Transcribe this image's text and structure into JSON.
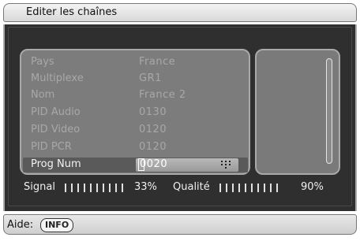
{
  "title": "Editer les chaînes",
  "fields": [
    {
      "label": "Pays",
      "value": "France"
    },
    {
      "label": "Multiplexe",
      "value": "GR1"
    },
    {
      "label": "Nom",
      "value": "France 2"
    },
    {
      "label": "PID Audio",
      "value": "0130"
    },
    {
      "label": "PID Video",
      "value": "0120"
    },
    {
      "label": "PID PCR",
      "value": "0120"
    }
  ],
  "selected_field": {
    "label": "Prog Num",
    "value": "0020"
  },
  "signal": {
    "label": "Signal",
    "percent_text": "33%",
    "level": 0.33
  },
  "quality": {
    "label": "Qualité",
    "percent_text": "90%",
    "level": 0.9
  },
  "help": {
    "label": "Aide:",
    "key": "INFO"
  },
  "icons": {
    "keypad": "numeric-keypad-icon"
  }
}
